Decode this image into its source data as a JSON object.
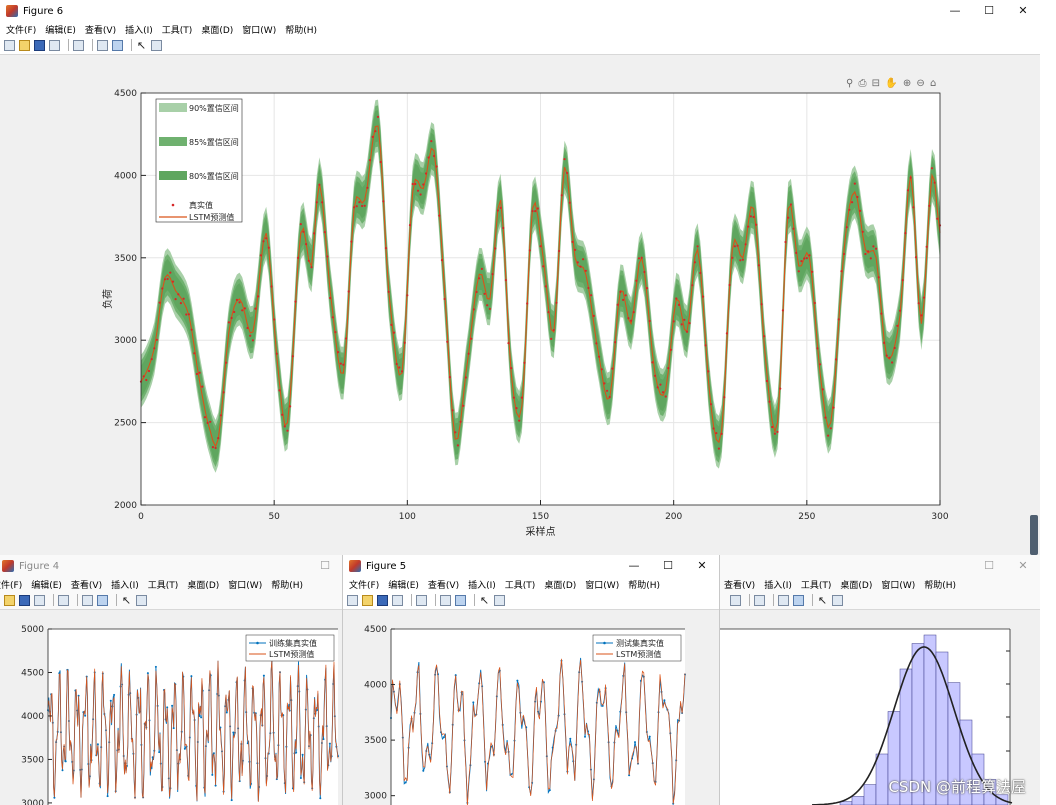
{
  "fig6": {
    "title": "Figure 6",
    "menus": [
      "文件(F)",
      "编辑(E)",
      "查看(V)",
      "插入(I)",
      "工具(T)",
      "桌面(D)",
      "窗口(W)",
      "帮助(H)"
    ],
    "minimize": "—",
    "maximize": "☐",
    "close": "✕",
    "axes_toolbar": "⚲ ⎙ ⊟ ✋ ⊕ ⊖ ⌂"
  },
  "fig4": {
    "title": "Figure 4",
    "menus": [
      "文件(F)",
      "编辑(E)",
      "查看(V)",
      "插入(I)",
      "工具(T)",
      "桌面(D)",
      "窗口(W)",
      "帮助(H)"
    ],
    "maximize": "☐"
  },
  "fig5": {
    "title": "Figure 5",
    "menus": [
      "文件(F)",
      "编辑(E)",
      "查看(V)",
      "插入(I)",
      "工具(T)",
      "桌面(D)",
      "窗口(W)",
      "帮助(H)"
    ],
    "minimize": "—",
    "maximize": "☐",
    "close": "✕"
  },
  "fig7": {
    "menus": [
      "查看(V)",
      "插入(I)",
      "工具(T)",
      "桌面(D)",
      "窗口(W)",
      "帮助(H)"
    ],
    "maximize": "☐",
    "close": "✕"
  },
  "watermark": "CSDN @前程算法屋",
  "colors": {
    "band90": "#a8d0a8",
    "band85": "#6fb16f",
    "band80": "#5fa65f",
    "true_points": "#d62728",
    "lstm_line": "#d95319",
    "train_line": "#0072bd",
    "histogram": "#c8c8ff"
  },
  "chart_data": [
    {
      "id": "fig6",
      "type": "line",
      "xlabel": "采样点",
      "ylabel": "负荷",
      "xlim": [
        0,
        300
      ],
      "ylim": [
        2000,
        4500
      ],
      "xticks": [
        0,
        50,
        100,
        150,
        200,
        250,
        300
      ],
      "yticks": [
        2000,
        2500,
        3000,
        3500,
        4000,
        4500
      ],
      "grid": true,
      "legend_position": "top-left",
      "legend": [
        "90%置信区间",
        "85%置信区间",
        "80%置信区间",
        "真实值",
        "LSTM预测值"
      ],
      "knots_x": [
        0,
        5,
        9,
        13,
        18,
        22,
        26,
        29,
        33,
        37,
        42,
        47,
        51,
        55,
        60,
        64,
        67,
        71,
        76,
        80,
        84,
        89,
        93,
        98,
        102,
        106,
        110,
        114,
        118,
        122,
        127,
        131,
        135,
        139,
        143,
        147,
        151,
        155,
        159,
        163,
        167,
        172,
        176,
        180,
        184,
        188,
        193,
        197,
        201,
        205,
        209,
        214,
        218,
        222,
        226,
        230,
        235,
        239,
        243,
        247,
        251,
        255,
        259,
        264,
        268,
        272,
        276,
        280,
        285,
        289,
        293,
        297,
        300
      ],
      "knots_y": [
        2750,
        2950,
        3380,
        3300,
        3150,
        2750,
        2450,
        2400,
        3050,
        3250,
        3050,
        3650,
        2900,
        2500,
        3650,
        3450,
        3950,
        3300,
        2800,
        3800,
        3850,
        4300,
        3300,
        2800,
        3900,
        3920,
        4150,
        3300,
        2400,
        2800,
        3400,
        3250,
        3850,
        2800,
        2600,
        3800,
        3500,
        3050,
        4050,
        3500,
        3400,
        2900,
        2650,
        3300,
        3100,
        3500,
        2800,
        2700,
        3250,
        3050,
        3550,
        2600,
        2450,
        3550,
        3500,
        3800,
        2800,
        2500,
        3800,
        3450,
        3500,
        2800,
        2500,
        3550,
        3900,
        3550,
        3500,
        2900,
        3150,
        4000,
        3100,
        4000,
        3650
      ],
      "band_halfwidth": {
        "90%置信区间": 160,
        "85%置信区间": 125,
        "80%置信区间": 95
      }
    },
    {
      "id": "fig4",
      "type": "line",
      "ylim_visible": [
        2700,
        5000
      ],
      "yticks": [
        3000,
        3500,
        4000,
        4500,
        5000
      ],
      "legend_position": "top-right",
      "legend": [
        "训练集真实值",
        "LSTM预测值"
      ],
      "amplitude_range": [
        2900,
        4700
      ]
    },
    {
      "id": "fig5",
      "type": "line",
      "ylim_visible": [
        2700,
        4500
      ],
      "yticks": [
        3000,
        3500,
        4000,
        4500
      ],
      "legend_position": "top-right",
      "legend": [
        "测试集真实值",
        "LSTM预测值"
      ]
    },
    {
      "id": "fig7",
      "type": "bar",
      "histogram_heights": [
        0.02,
        0.05,
        0.12,
        0.3,
        0.55,
        0.8,
        0.95,
        1.0,
        0.9,
        0.72,
        0.5,
        0.3,
        0.15,
        0.06
      ],
      "has_fit_curve": true
    }
  ]
}
